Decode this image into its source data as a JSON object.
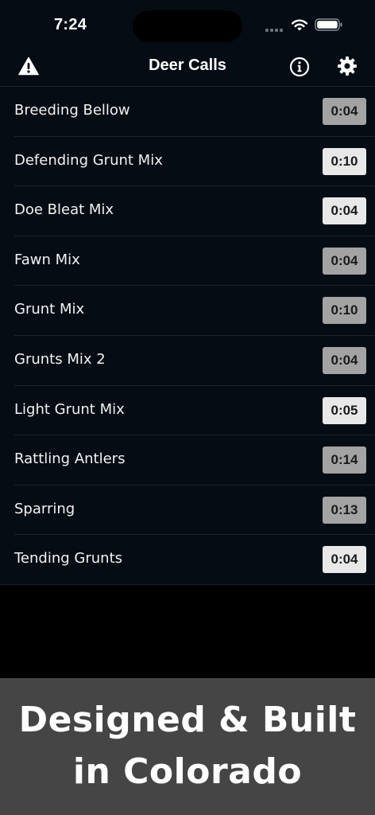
{
  "status_bar": {
    "time": "7:24",
    "signal_icon": "cellular-signal-icon",
    "wifi_icon": "wifi-icon",
    "battery_icon": "battery-icon"
  },
  "nav": {
    "title": "Deer Calls",
    "left_icon": "warning-icon",
    "right_icons": [
      "info-icon",
      "gear-icon"
    ]
  },
  "calls": [
    {
      "name": "Breeding Bellow",
      "duration": "0:04",
      "badge": "dark"
    },
    {
      "name": "Defending Grunt Mix",
      "duration": "0:10",
      "badge": "light"
    },
    {
      "name": "Doe Bleat Mix",
      "duration": "0:04",
      "badge": "light"
    },
    {
      "name": "Fawn Mix",
      "duration": "0:04",
      "badge": "dark"
    },
    {
      "name": "Grunt Mix",
      "duration": "0:10",
      "badge": "dark"
    },
    {
      "name": "Grunts Mix 2",
      "duration": "0:04",
      "badge": "dark"
    },
    {
      "name": "Light Grunt Mix",
      "duration": "0:05",
      "badge": "light"
    },
    {
      "name": "Rattling Antlers",
      "duration": "0:14",
      "badge": "dark"
    },
    {
      "name": "Sparring",
      "duration": "0:13",
      "badge": "dark"
    },
    {
      "name": "Tending Grunts",
      "duration": "0:04",
      "badge": "light"
    }
  ],
  "banner": {
    "line1": "Designed & Built",
    "line2": "in Colorado"
  },
  "colors": {
    "app_background": "#060c14",
    "badge_dark": "#a3a3a3",
    "badge_light": "#e8e8e8",
    "banner_background": "#454545"
  }
}
